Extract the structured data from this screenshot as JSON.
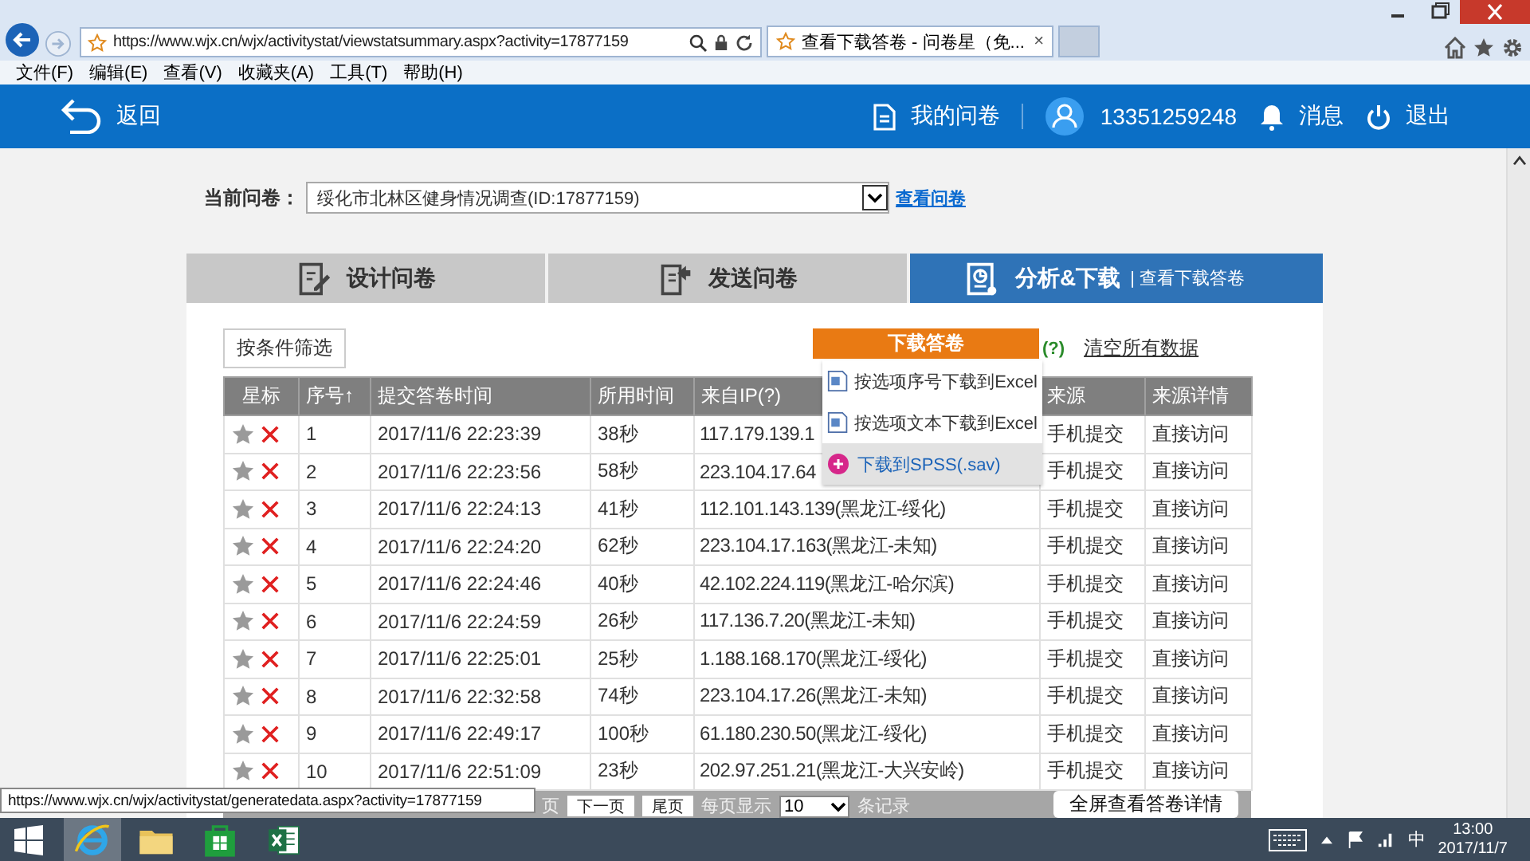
{
  "browser": {
    "url": "https://www.wjx.cn/wjx/activitystat/viewstatsummary.aspx?activity=17877159",
    "tab_title": "查看下载答卷 - 问卷星（免...",
    "tab_close": "×",
    "menu": [
      "文件(F)",
      "编辑(E)",
      "查看(V)",
      "收藏夹(A)",
      "工具(T)",
      "帮助(H)"
    ]
  },
  "header": {
    "back": "返回",
    "my_surveys": "我的问卷",
    "account": "13351259248",
    "messages": "消息",
    "logout": "退出"
  },
  "survey_selector": {
    "label": "当前问卷：",
    "value": "绥化市北林区健身情况调查(ID:17877159)",
    "link": "查看问卷"
  },
  "tabs": [
    {
      "label": "设计问卷",
      "selected": false,
      "kind": "design"
    },
    {
      "label": "发送问卷",
      "selected": false,
      "kind": "send"
    },
    {
      "label": "分析&下载",
      "selected": true,
      "kind": "analyze",
      "sub_link": "| 查看下载答卷"
    }
  ],
  "filter_button": "按条件筛选",
  "download": {
    "label": "下载答卷",
    "help": "(?)",
    "expanded": true,
    "items": [
      {
        "label": "按选项序号下载到Excel",
        "kind": "excel",
        "highlighted": false
      },
      {
        "label": "按选项文本下载到Excel",
        "kind": "excel",
        "highlighted": false
      },
      {
        "label": "下载到SPSS(.sav)",
        "kind": "spss",
        "highlighted": true
      }
    ]
  },
  "clear_link": "清空所有数据",
  "table": {
    "columns": [
      "星标",
      "序号↑",
      "提交答卷时间",
      "所用时间",
      "来自IP(?)",
      "来源",
      "来源详情"
    ],
    "rows": [
      {
        "index": "1",
        "time": "2017/11/6 22:23:39",
        "duration": "38秒",
        "ip": "117.179.139.1",
        "source": "手机提交",
        "detail": "直接访问",
        "starred": false
      },
      {
        "index": "2",
        "time": "2017/11/6 22:23:56",
        "duration": "58秒",
        "ip": "223.104.17.64",
        "source": "手机提交",
        "detail": "直接访问",
        "starred": false
      },
      {
        "index": "3",
        "time": "2017/11/6 22:24:13",
        "duration": "41秒",
        "ip": "112.101.143.139(黑龙江-绥化)",
        "source": "手机提交",
        "detail": "直接访问",
        "starred": false
      },
      {
        "index": "4",
        "time": "2017/11/6 22:24:20",
        "duration": "62秒",
        "ip": "223.104.17.163(黑龙江-未知)",
        "source": "手机提交",
        "detail": "直接访问",
        "starred": false
      },
      {
        "index": "5",
        "time": "2017/11/6 22:24:46",
        "duration": "40秒",
        "ip": "42.102.224.119(黑龙江-哈尔滨)",
        "source": "手机提交",
        "detail": "直接访问",
        "starred": false
      },
      {
        "index": "6",
        "time": "2017/11/6 22:24:59",
        "duration": "26秒",
        "ip": "117.136.7.20(黑龙江-未知)",
        "source": "手机提交",
        "detail": "直接访问",
        "starred": false
      },
      {
        "index": "7",
        "time": "2017/11/6 22:25:01",
        "duration": "25秒",
        "ip": "1.188.168.170(黑龙江-绥化)",
        "source": "手机提交",
        "detail": "直接访问",
        "starred": false
      },
      {
        "index": "8",
        "time": "2017/11/6 22:32:58",
        "duration": "74秒",
        "ip": "223.104.17.26(黑龙江-未知)",
        "source": "手机提交",
        "detail": "直接访问",
        "starred": false
      },
      {
        "index": "9",
        "time": "2017/11/6 22:49:17",
        "duration": "100秒",
        "ip": "61.180.230.50(黑龙江-绥化)",
        "source": "手机提交",
        "detail": "直接访问",
        "starred": false
      },
      {
        "index": "10",
        "time": "2017/11/6 22:51:09",
        "duration": "23秒",
        "ip": "202.97.251.21(黑龙江-大兴安岭)",
        "source": "手机提交",
        "detail": "直接访问",
        "starred": false
      }
    ]
  },
  "pager": {
    "prev_partial": "页",
    "next": "下一页",
    "last": "尾页",
    "per_page_label": "每页显示",
    "per_page": "10",
    "records_label": "条记录",
    "fullscreen": "全屏查看答卷详情"
  },
  "status_url": "https://www.wjx.cn/wjx/activitystat/generatedata.aspx?activity=17877159",
  "taskbar": {
    "apps": [
      {
        "kind": "ie",
        "selected": true
      },
      {
        "kind": "folder",
        "selected": false
      },
      {
        "kind": "store",
        "selected": false
      },
      {
        "kind": "excel",
        "selected": false
      }
    ],
    "ime": "中",
    "time": "13:00",
    "date": "2017/11/7"
  }
}
